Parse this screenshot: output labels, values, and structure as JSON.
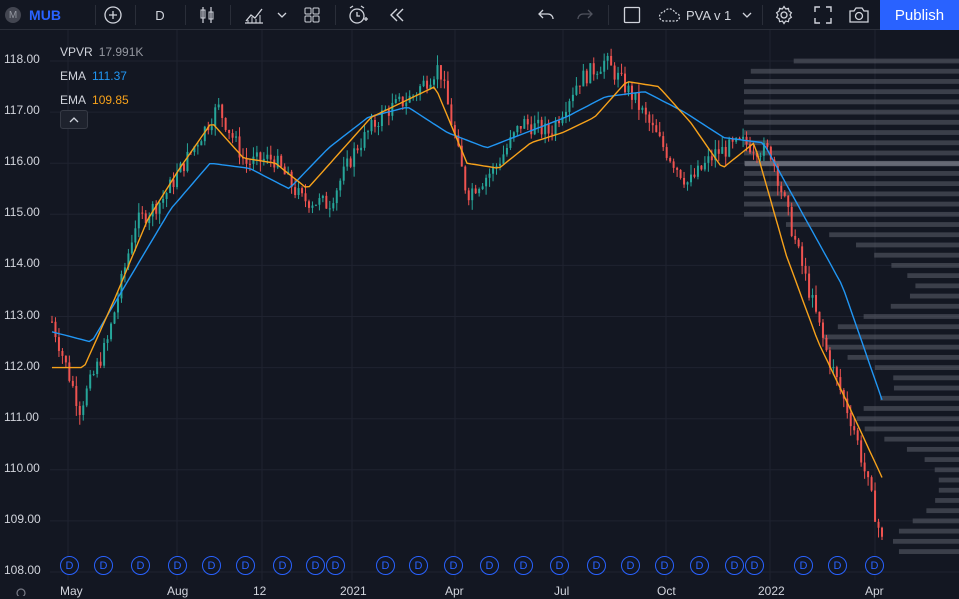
{
  "toolbar": {
    "avatar_letter": "M",
    "symbol": "MUB",
    "interval": "D",
    "layout_name": "PVA v 1",
    "publish_label": "Publish"
  },
  "legend": {
    "vpvr_label": "VPVR",
    "vpvr_value": "17.991K",
    "ema1_label": "EMA",
    "ema1_value": "111.37",
    "ema2_label": "EMA",
    "ema2_value": "109.85",
    "colors": {
      "ema_fast": "#f7a21b",
      "ema_slow": "#2196f3",
      "up": "#26a69a",
      "down": "#ef5350"
    }
  },
  "price_axis": [
    "118.00",
    "117.00",
    "116.00",
    "115.00",
    "114.00",
    "113.00",
    "112.00",
    "111.00",
    "110.00",
    "109.00",
    "108.00"
  ],
  "time_axis": [
    "May",
    "Aug",
    "12",
    "2021",
    "Apr",
    "Jul",
    "Oct",
    "2022",
    "Apr"
  ],
  "dividend_marker": "D",
  "chart_data": {
    "type": "line",
    "symbol": "MUB",
    "ylim": [
      108,
      118.4
    ],
    "price_ticks": [
      118,
      117,
      116,
      115,
      114,
      113,
      112,
      111,
      110,
      109,
      108
    ],
    "x_labels": [
      "May",
      "Aug",
      "12",
      "2021",
      "Apr",
      "Jul",
      "Oct",
      "2022",
      "Apr"
    ],
    "series": [
      {
        "name": "close",
        "values": [
          112.9,
          111.2,
          112.5,
          114.8,
          115.3,
          116.2,
          117.1,
          116.0,
          116.1,
          115.3,
          115.2,
          116.3,
          117.0,
          117.3,
          117.9,
          115.4,
          115.9,
          116.8,
          116.6,
          117.6,
          118.0,
          117.3,
          116.4,
          115.6,
          116.2,
          116.4,
          116.2,
          114.2,
          112.3,
          110.8,
          108.6
        ]
      },
      {
        "name": "EMA",
        "values": [
          112.0,
          112.0,
          113.4,
          114.9,
          115.9,
          116.8,
          116.1,
          116.0,
          115.5,
          116.2,
          116.9,
          117.2,
          117.5,
          116.0,
          115.9,
          116.4,
          116.6,
          116.9,
          117.6,
          117.5,
          116.8,
          115.9,
          116.4,
          114.2,
          112.5,
          111.2,
          109.85
        ]
      },
      {
        "name": "EMA",
        "values": [
          112.7,
          112.5,
          113.8,
          115.1,
          116.0,
          115.9,
          115.5,
          116.3,
          116.9,
          117.1,
          116.6,
          116.3,
          116.6,
          116.9,
          117.3,
          117.4,
          117.0,
          116.5,
          116.4,
          115.0,
          113.6,
          111.37
        ]
      }
    ],
    "volume_profile_right": true,
    "grid": true
  }
}
